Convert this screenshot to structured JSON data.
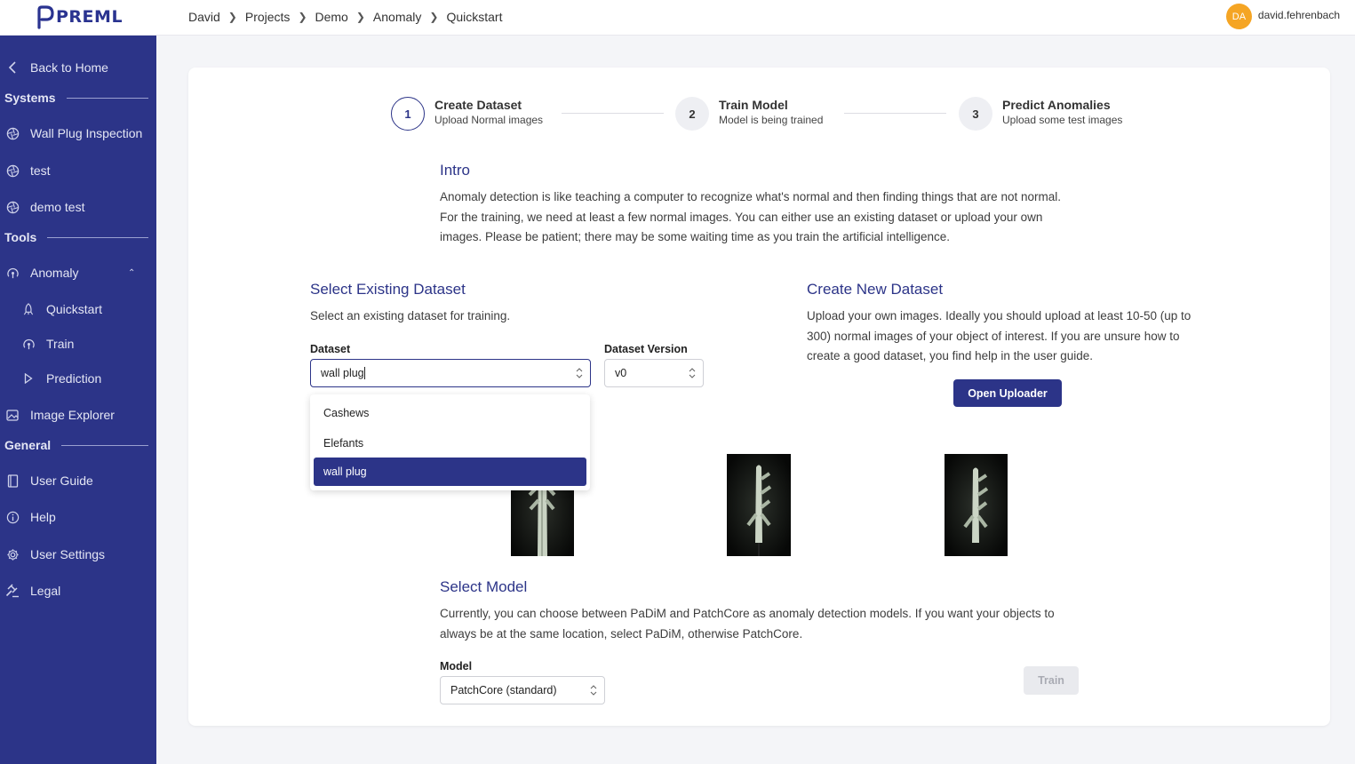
{
  "app": {
    "logo_text_a": "PRE",
    "logo_text_b": "ML"
  },
  "breadcrumb": [
    "David",
    "Projects",
    "Demo",
    "Anomaly",
    "Quickstart"
  ],
  "user": {
    "initials": "DA",
    "name": "david.fehrenbach",
    "avatar_color": "#f5a524"
  },
  "sidebar": {
    "back": "Back to Home",
    "sections": {
      "systems": "Systems",
      "tools": "Tools",
      "general": "General"
    },
    "systems": [
      "Wall Plug Inspection",
      "test",
      "demo test"
    ],
    "tools": {
      "anomaly": "Anomaly",
      "quickstart": "Quickstart",
      "train": "Train",
      "prediction": "Prediction",
      "image_explorer": "Image Explorer"
    },
    "general": [
      "User Guide",
      "Help",
      "User Settings",
      "Legal"
    ]
  },
  "stepper": [
    {
      "num": "1",
      "title": "Create Dataset",
      "desc": "Upload Normal images",
      "active": true
    },
    {
      "num": "2",
      "title": "Train Model",
      "desc": "Model is being trained",
      "active": false
    },
    {
      "num": "3",
      "title": "Predict Anomalies",
      "desc": "Upload some test images",
      "active": false
    }
  ],
  "intro": {
    "title": "Intro",
    "text": "Anomaly detection is like teaching a computer to recognize what's normal and then finding things that are not normal. For the training, we need at least a few normal images. You can either use an existing dataset or upload your own images. Please be patient; there may be some waiting time as you train the artificial intelligence."
  },
  "existing": {
    "title": "Select Existing Dataset",
    "text": "Select an existing dataset for training.",
    "dataset_label": "Dataset",
    "dataset_value": "wall plug",
    "version_label": "Dataset Version",
    "version_value": "v0",
    "options": [
      "Cashews",
      "Elefants",
      "wall plug"
    ],
    "selected_option": "wall plug"
  },
  "create_new": {
    "title": "Create New Dataset",
    "text": "Upload your own images. Ideally you should upload at least 10-50 (up to 300) normal images of your object of interest. If you are unsure how to create a good dataset, you find help in the user guide.",
    "button": "Open Uploader"
  },
  "model": {
    "title": "Select Model",
    "text": "Currently, you can choose between PaDiM and PatchCore as anomaly detection models. If you want your objects to always be at the same location, select PaDiM, otherwise PatchCore.",
    "label": "Model",
    "value": "PatchCore (standard)",
    "train_button": "Train"
  },
  "colors": {
    "primary": "#2c3488",
    "accent": "#f5a524"
  }
}
